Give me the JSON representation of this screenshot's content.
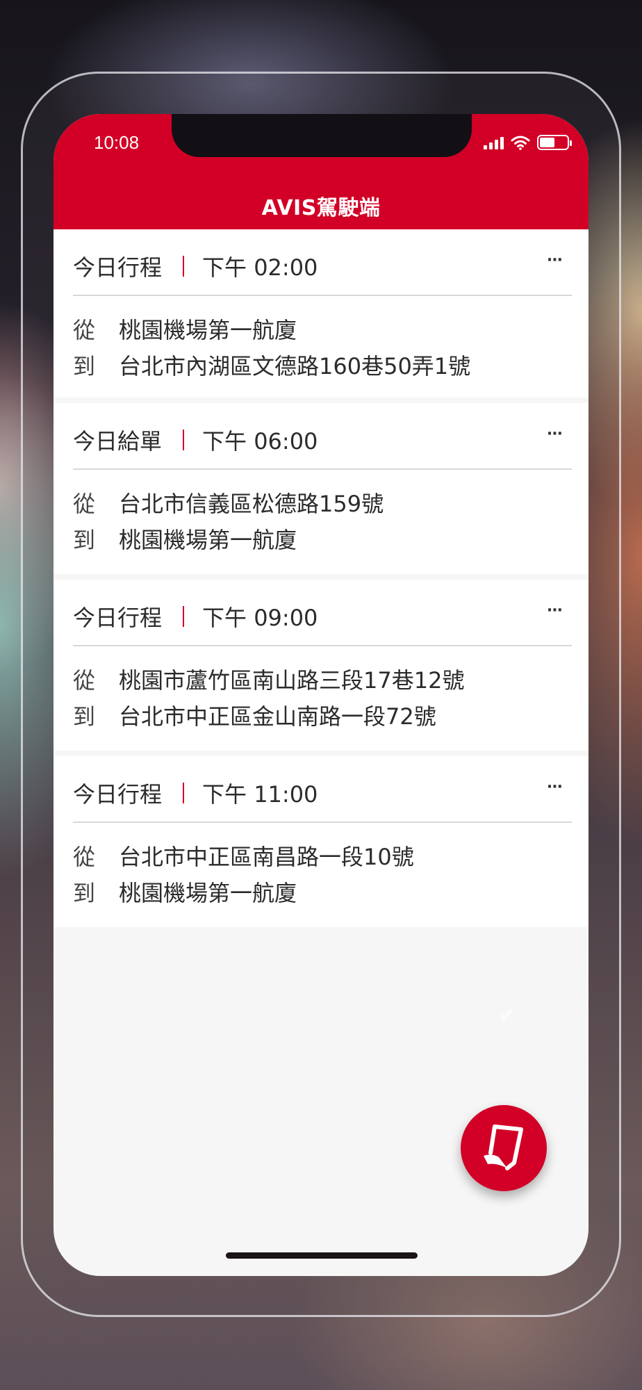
{
  "status_bar": {
    "time": "10:08"
  },
  "app": {
    "title": "AVIS駕駛端"
  },
  "trips": [
    {
      "type": "今日行程",
      "time": "下午 02:00",
      "from_label": "從",
      "from": "桃園機場第一航廈",
      "to_label": "到",
      "to": "台北市內湖區文德路160巷50弄1號",
      "more": "···"
    },
    {
      "type": "今日給單",
      "time": "下午 06:00",
      "from_label": "從",
      "from": "台北市信義區松德路159號",
      "to_label": "到",
      "to": "桃園機場第一航廈",
      "more": "···"
    },
    {
      "type": "今日行程",
      "time": "下午 09:00",
      "from_label": "從",
      "from": "桃園市蘆竹區南山路三段17巷12號",
      "to_label": "到",
      "to": "台北市中正區金山南路一段72號",
      "more": "···"
    },
    {
      "type": "今日行程",
      "time": "下午 11:00",
      "from_label": "從",
      "from": "台北市中正區南昌路一段10號",
      "to_label": "到",
      "to": "桃園機場第一航廈",
      "more": "···"
    }
  ],
  "colors": {
    "brand": "#d20026",
    "card": "#ffffff",
    "background": "#f6f6f6"
  },
  "icons": {
    "fab": "receipt-icon",
    "status": [
      "signal-icon",
      "wifi-icon",
      "battery-icon"
    ]
  }
}
